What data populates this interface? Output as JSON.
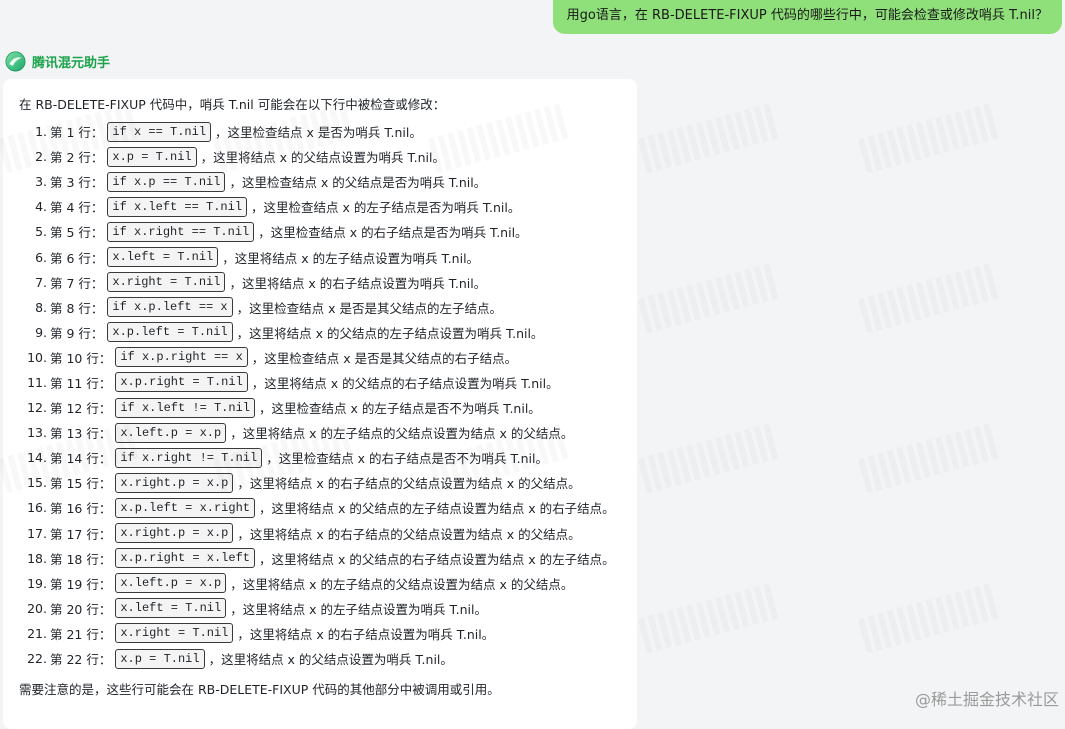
{
  "user_message": "用go语言，在 RB-DELETE-FIXUP 代码的哪些行中，可能会检查或修改哨兵 T.nil？",
  "assistant": {
    "name": "腾讯混元助手",
    "logo_icon": "hunyuan-logo-icon"
  },
  "answer": {
    "intro": "在 RB-DELETE-FIXUP 代码中，哨兵 T.nil 可能会在以下行中被检查或修改：",
    "items": [
      {
        "num": "1.",
        "label": "第 1 行：",
        "code": "if x == T.nil",
        "desc": "，这里检查结点 x 是否为哨兵 T.nil。"
      },
      {
        "num": "2.",
        "label": "第 2 行：",
        "code": "x.p = T.nil",
        "desc": "，这里将结点 x 的父结点设置为哨兵 T.nil。"
      },
      {
        "num": "3.",
        "label": "第 3 行：",
        "code": "if x.p == T.nil",
        "desc": "，这里检查结点 x 的父结点是否为哨兵 T.nil。"
      },
      {
        "num": "4.",
        "label": "第 4 行：",
        "code": "if x.left == T.nil",
        "desc": "，这里检查结点 x 的左子结点是否为哨兵 T.nil。"
      },
      {
        "num": "5.",
        "label": "第 5 行：",
        "code": "if x.right == T.nil",
        "desc": "，这里检查结点 x 的右子结点是否为哨兵 T.nil。"
      },
      {
        "num": "6.",
        "label": "第 6 行：",
        "code": "x.left = T.nil",
        "desc": "，这里将结点 x 的左子结点设置为哨兵 T.nil。"
      },
      {
        "num": "7.",
        "label": "第 7 行：",
        "code": "x.right = T.nil",
        "desc": "，这里将结点 x 的右子结点设置为哨兵 T.nil。"
      },
      {
        "num": "8.",
        "label": "第 8 行：",
        "code": "if x.p.left == x",
        "desc": "，这里检查结点 x 是否是其父结点的左子结点。"
      },
      {
        "num": "9.",
        "label": "第 9 行：",
        "code": "x.p.left = T.nil",
        "desc": "，这里将结点 x 的父结点的左子结点设置为哨兵 T.nil。"
      },
      {
        "num": "10.",
        "label": "第 10 行：",
        "code": "if x.p.right == x",
        "desc": "，这里检查结点 x 是否是其父结点的右子结点。"
      },
      {
        "num": "11.",
        "label": "第 11 行：",
        "code": "x.p.right = T.nil",
        "desc": "，这里将结点 x 的父结点的右子结点设置为哨兵 T.nil。"
      },
      {
        "num": "12.",
        "label": "第 12 行：",
        "code": "if x.left != T.nil",
        "desc": "，这里检查结点 x 的左子结点是否不为哨兵 T.nil。"
      },
      {
        "num": "13.",
        "label": "第 13 行：",
        "code": "x.left.p = x.p",
        "desc": "，这里将结点 x 的左子结点的父结点设置为结点 x 的父结点。"
      },
      {
        "num": "14.",
        "label": "第 14 行：",
        "code": "if x.right != T.nil",
        "desc": "，这里检查结点 x 的右子结点是否不为哨兵 T.nil。"
      },
      {
        "num": "15.",
        "label": "第 15 行：",
        "code": "x.right.p = x.p",
        "desc": "，这里将结点 x 的右子结点的父结点设置为结点 x 的父结点。"
      },
      {
        "num": "16.",
        "label": "第 16 行：",
        "code": "x.p.left = x.right",
        "desc": "，这里将结点 x 的父结点的左子结点设置为结点 x 的右子结点。"
      },
      {
        "num": "17.",
        "label": "第 17 行：",
        "code": "x.right.p = x.p",
        "desc": "，这里将结点 x 的右子结点的父结点设置为结点 x 的父结点。"
      },
      {
        "num": "18.",
        "label": "第 18 行：",
        "code": "x.p.right = x.left",
        "desc": "，这里将结点 x 的父结点的右子结点设置为结点 x 的左子结点。"
      },
      {
        "num": "19.",
        "label": "第 19 行：",
        "code": "x.left.p = x.p",
        "desc": "，这里将结点 x 的左子结点的父结点设置为结点 x 的父结点。"
      },
      {
        "num": "20.",
        "label": "第 20 行：",
        "code": "x.left = T.nil",
        "desc": "，这里将结点 x 的左子结点设置为哨兵 T.nil。"
      },
      {
        "num": "21.",
        "label": "第 21 行：",
        "code": "x.right = T.nil",
        "desc": "，这里将结点 x 的右子结点设置为哨兵 T.nil。"
      },
      {
        "num": "22.",
        "label": "第 22 行：",
        "code": "x.p = T.nil",
        "desc": "，这里将结点 x 的父结点设置为哨兵 T.nil。"
      }
    ],
    "outro": "需要注意的是，这些行可能会在 RB-DELETE-FIXUP 代码的其他部分中被调用或引用。"
  },
  "site_watermark": "@稀土掘金技术社区",
  "colors": {
    "user_bubble": "#8fe07a",
    "assistant_name": "#1aa34a",
    "card_bg": "#ffffff",
    "page_bg": "#f3f4f5"
  }
}
